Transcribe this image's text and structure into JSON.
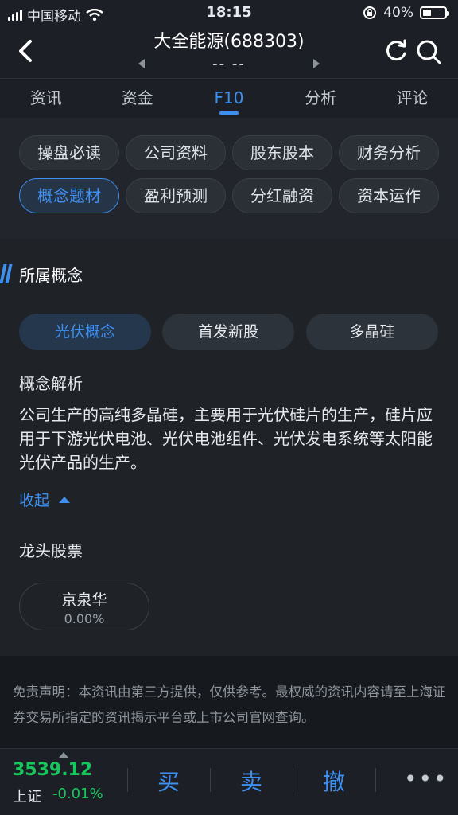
{
  "status_bar": {
    "carrier": "中国移动",
    "time": "18:15",
    "battery": "40%",
    "battery_level": 0.4
  },
  "header": {
    "title": "大全能源(688303)",
    "subtitle": "-- --"
  },
  "tabs": [
    {
      "label": "资讯"
    },
    {
      "label": "资金"
    },
    {
      "label": "F10"
    },
    {
      "label": "分析"
    },
    {
      "label": "评论"
    }
  ],
  "chips": [
    {
      "label": "操盘必读"
    },
    {
      "label": "公司资料"
    },
    {
      "label": "股东股本"
    },
    {
      "label": "财务分析"
    },
    {
      "label": "概念题材"
    },
    {
      "label": "盈利预测"
    },
    {
      "label": "分红融资"
    },
    {
      "label": "资本运作"
    }
  ],
  "concept": {
    "title": "所属概念",
    "pills": [
      {
        "label": "光伏概念"
      },
      {
        "label": "首发新股"
      },
      {
        "label": "多晶硅"
      }
    ],
    "analysis_label": "概念解析",
    "analysis_text": "公司生产的高纯多晶硅，主要用于光伏硅片的生产，硅片应用于下游光伏电池、光伏电池组件、光伏发电系统等太阳能光伏产品的生产。",
    "collapse_label": "收起",
    "leader_label": "龙头股票",
    "leader_stock": {
      "name": "京泉华",
      "change": "0.00%"
    }
  },
  "disclaimer": "免责声明：本资讯由第三方提供，仅供参考。最权威的资讯内容请至上海证券交易所指定的资讯揭示平台或上市公司官网查询。",
  "bottom_bar": {
    "index_value": "3539.12",
    "index_name": "上证",
    "index_change": "-0.01%",
    "buy": "买",
    "sell": "卖",
    "cancel": "撤",
    "more": "•••"
  },
  "colors": {
    "accent": "#3d8ff0",
    "down_green": "#16c75c",
    "background": "#16191d"
  }
}
